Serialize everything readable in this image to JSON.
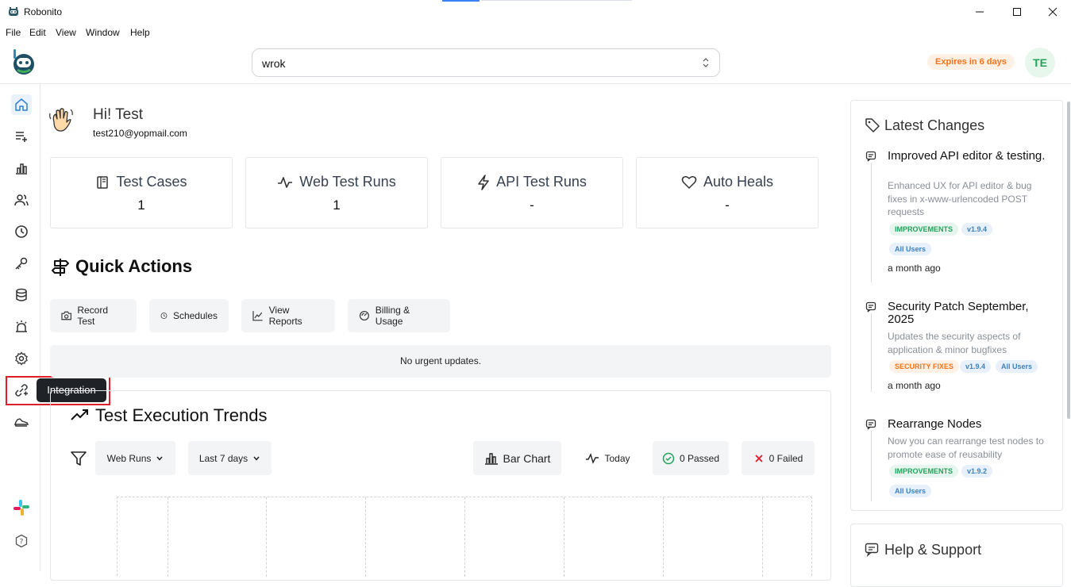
{
  "window": {
    "title": "Robonito",
    "icons": [
      "app-logo-icon",
      "minimize-icon",
      "maximize-icon",
      "close-icon"
    ]
  },
  "menu": [
    "File",
    "Edit",
    "View",
    "Window",
    "Help"
  ],
  "header": {
    "search_value": "wrok",
    "expires": "Expires in 6 days",
    "avatar_initials": "TE"
  },
  "sidebar": {
    "items": [
      "home-icon",
      "add-list-icon",
      "reports-icon",
      "users-icon",
      "clock-icon",
      "key-icon",
      "database-icon",
      "alarm-icon",
      "settings-icon",
      "integration-icon",
      "shoe-icon"
    ],
    "bottom": [
      "slack-icon",
      "help-icon"
    ],
    "tooltip": "Integration"
  },
  "greeting": {
    "title": "Hi! Test",
    "email": "test210@yopmail.com"
  },
  "stats": [
    {
      "label": "Test Cases",
      "value": "1",
      "icon": "book-icon"
    },
    {
      "label": "Web Test Runs",
      "value": "1",
      "icon": "activity-icon"
    },
    {
      "label": "API Test Runs",
      "value": "-",
      "icon": "lightning-icon"
    },
    {
      "label": "Auto Heals",
      "value": "-",
      "icon": "heart-icon"
    }
  ],
  "quick_actions": {
    "title": "Quick Actions",
    "buttons": [
      "Record Test",
      "Schedules",
      "View Reports",
      "Billing & Usage"
    ],
    "urgent": "No urgent updates."
  },
  "trends": {
    "title": "Test Execution Trends",
    "run_type": "Web Runs",
    "range": "Last 7 days",
    "chart_type": "Bar Chart",
    "today": "Today",
    "passed": "0 Passed",
    "failed": "0 Failed"
  },
  "changes": {
    "title": "Latest Changes",
    "items": [
      {
        "title": "Improved API editor & testing.",
        "desc": "Enhanced UX for API editor & bug fixes in x-www-urlencoded POST requests",
        "badges": [
          "IMPROVEMENTS",
          "v1.9.4",
          "All Users"
        ],
        "ago": "a month ago"
      },
      {
        "title": "Security Patch September, 2025",
        "desc": "Updates the security aspects of application & minor bugfixes",
        "badges": [
          "SECURITY FIXES",
          "v1.9.4",
          "All Users"
        ],
        "ago": "a month ago"
      },
      {
        "title": "Rearrange Nodes",
        "desc": "Now you can rearrange test nodes to promote ease of reusability",
        "badges": [
          "IMPROVEMENTS",
          "v1.9.2",
          "All Users"
        ]
      }
    ]
  },
  "help": {
    "title": "Help & Support"
  },
  "colors": {
    "accent": "#3b82f6",
    "success": "#22a35a",
    "danger": "#e11d2a",
    "warning": "#f97316"
  }
}
